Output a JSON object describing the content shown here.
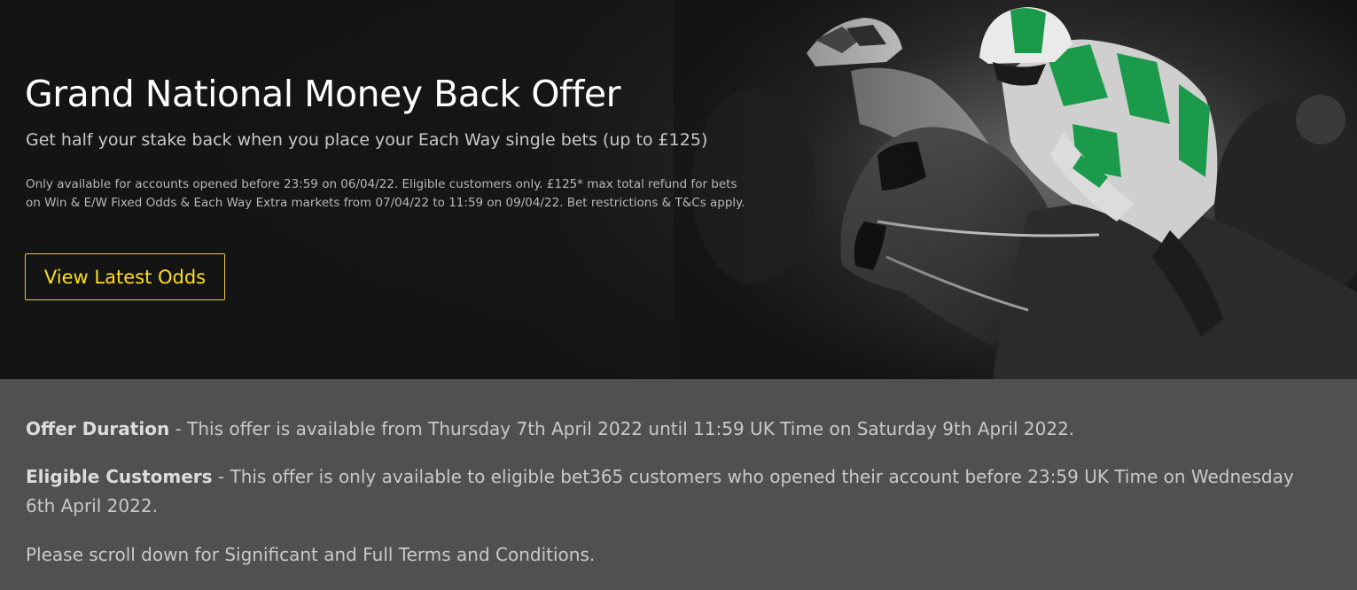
{
  "hero": {
    "title": "Grand National Money Back Offer",
    "subtitle": "Get half your stake back when you place your Each Way single bets (up to £125)",
    "terms": "Only available for accounts opened before 23:59 on 06/04/22. Eligible customers only. £125* max total refund for bets on Win & E/W Fixed Odds & Each Way Extra markets from 07/04/22 to 11:59 on 09/04/22. Bet restrictions & T&Cs apply.",
    "cta_label": "View Latest Odds",
    "image_icon": "horse-racing-jockeys-image",
    "colors": {
      "accent": "#ffdf1b",
      "jockey_silks": "#1a9a4a"
    }
  },
  "info": {
    "offer_duration_label": "Offer Duration",
    "offer_duration_text": " - This offer is available from Thursday 7th April 2022 until 11:59 UK Time on Saturday 9th April 2022.",
    "eligible_label": "Eligible Customers",
    "eligible_text": " - This offer is only available to eligible bet365 customers who opened their account before 23:59 UK Time on Wednesday 6th April 2022.",
    "scroll_note": "Please scroll down for Significant and Full Terms and Conditions."
  }
}
